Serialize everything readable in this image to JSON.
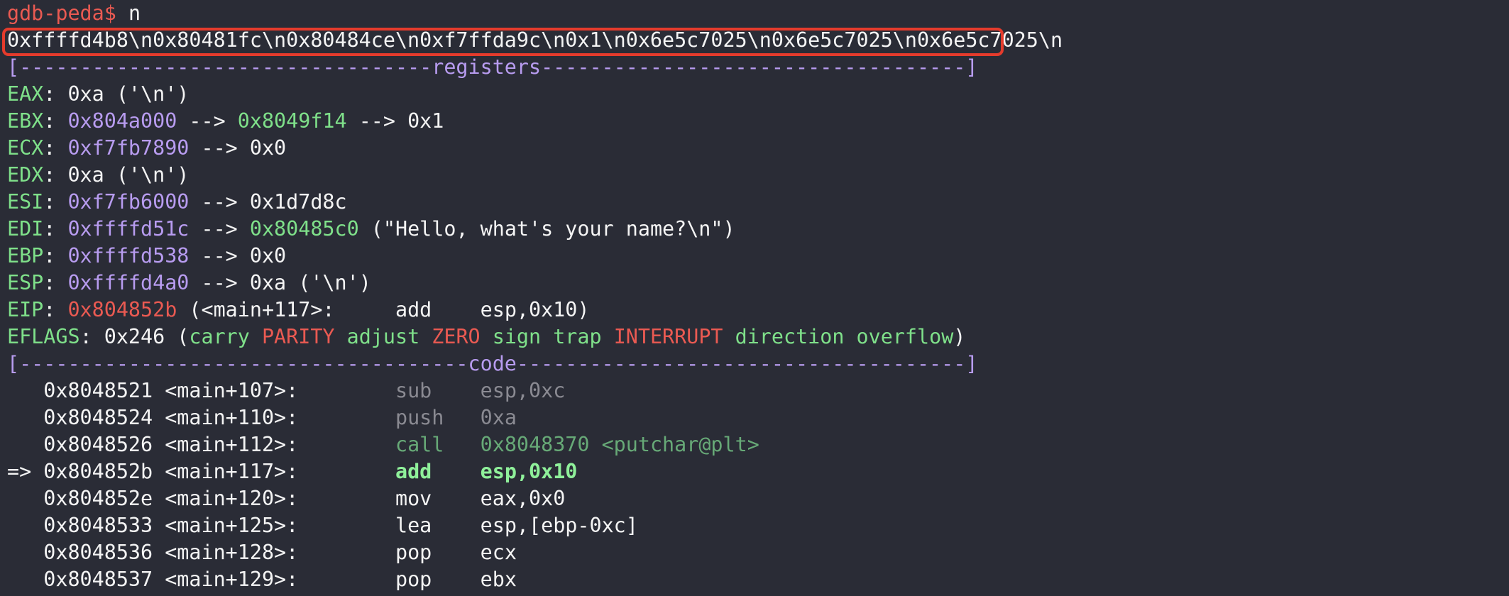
{
  "prompt": {
    "text": "gdb-peda$",
    "command": "n"
  },
  "output_line": "0xffffd4b8\\n0x80481fc\\n0x80484ce\\n0xf7ffda9c\\n0x1\\n0x6e5c7025\\n0x6e5c7025\\n0x6e5c7025\\n",
  "registers_header": "[----------------------------------registers-----------------------------------]",
  "registers": [
    {
      "name": "EAX",
      "segments": [
        {
          "t": "0xa ('\\n')",
          "c": "white"
        }
      ]
    },
    {
      "name": "EBX",
      "segments": [
        {
          "t": "0x804a000",
          "c": "purple"
        },
        {
          "t": " --> ",
          "c": "white"
        },
        {
          "t": "0x8049f14",
          "c": "green"
        },
        {
          "t": " --> 0x1",
          "c": "white"
        }
      ]
    },
    {
      "name": "ECX",
      "segments": [
        {
          "t": "0xf7fb7890",
          "c": "purple"
        },
        {
          "t": " --> 0x0",
          "c": "white"
        }
      ]
    },
    {
      "name": "EDX",
      "segments": [
        {
          "t": "0xa ('\\n')",
          "c": "white"
        }
      ]
    },
    {
      "name": "ESI",
      "segments": [
        {
          "t": "0xf7fb6000",
          "c": "purple"
        },
        {
          "t": " --> 0x1d7d8c",
          "c": "white"
        }
      ]
    },
    {
      "name": "EDI",
      "segments": [
        {
          "t": "0xffffd51c",
          "c": "purple"
        },
        {
          "t": " --> ",
          "c": "white"
        },
        {
          "t": "0x80485c0",
          "c": "green"
        },
        {
          "t": " (\"Hello, what's your name?\\n\")",
          "c": "white"
        }
      ]
    },
    {
      "name": "EBP",
      "segments": [
        {
          "t": "0xffffd538",
          "c": "purple"
        },
        {
          "t": " --> 0x0",
          "c": "white"
        }
      ]
    },
    {
      "name": "ESP",
      "segments": [
        {
          "t": "0xffffd4a0",
          "c": "purple"
        },
        {
          "t": " --> 0xa ('\\n')",
          "c": "white"
        }
      ]
    },
    {
      "name": "EIP",
      "segments": [
        {
          "t": "0x804852b",
          "c": "red"
        },
        {
          "t": " (<main+117>:     add    esp,0x10)",
          "c": "white"
        }
      ]
    },
    {
      "name": "EFLAGS",
      "segments": [
        {
          "t": "0x246 (",
          "c": "white"
        },
        {
          "t": "carry ",
          "c": "green"
        },
        {
          "t": "PARITY ",
          "c": "red"
        },
        {
          "t": "adjust ",
          "c": "green"
        },
        {
          "t": "ZERO ",
          "c": "red"
        },
        {
          "t": "sign trap ",
          "c": "green"
        },
        {
          "t": "INTERRUPT ",
          "c": "red"
        },
        {
          "t": "direction overflow",
          "c": "green"
        },
        {
          "t": ")",
          "c": "white"
        }
      ]
    }
  ],
  "code_header": "[-------------------------------------code-------------------------------------]",
  "code": [
    {
      "marker": "   ",
      "addr": "0x8048521",
      "sym": "<main+107>:",
      "mnemonic": "sub",
      "operands": "esp,0xc",
      "style": "dim",
      "extra": ""
    },
    {
      "marker": "   ",
      "addr": "0x8048524",
      "sym": "<main+110>:",
      "mnemonic": "push",
      "operands": "0xa",
      "style": "dim",
      "extra": ""
    },
    {
      "marker": "   ",
      "addr": "0x8048526",
      "sym": "<main+112>:",
      "mnemonic": "call",
      "operands": "0x8048370",
      "style": "dimgreen",
      "extra": " <putchar@plt>"
    },
    {
      "marker": "=> ",
      "addr": "0x804852b",
      "sym": "<main+117>:",
      "mnemonic": "add",
      "operands": "esp,0x10",
      "style": "current",
      "extra": ""
    },
    {
      "marker": "   ",
      "addr": "0x804852e",
      "sym": "<main+120>:",
      "mnemonic": "mov",
      "operands": "eax,0x0",
      "style": "normal",
      "extra": ""
    },
    {
      "marker": "   ",
      "addr": "0x8048533",
      "sym": "<main+125>:",
      "mnemonic": "lea",
      "operands": "esp,[ebp-0xc]",
      "style": "normal",
      "extra": ""
    },
    {
      "marker": "   ",
      "addr": "0x8048536",
      "sym": "<main+128>:",
      "mnemonic": "pop",
      "operands": "ecx",
      "style": "normal",
      "extra": ""
    },
    {
      "marker": "   ",
      "addr": "0x8048537",
      "sym": "<main+129>:",
      "mnemonic": "pop",
      "operands": "ebx",
      "style": "normal",
      "extra": ""
    }
  ],
  "colors": {
    "background": "#2a2c36",
    "text": "#f4f4f4",
    "red": "#ea5a52",
    "green": "#7fe08a",
    "purple": "#b89cf0",
    "dim": "#8a8a92",
    "highlight_box": "#e53b2c"
  }
}
